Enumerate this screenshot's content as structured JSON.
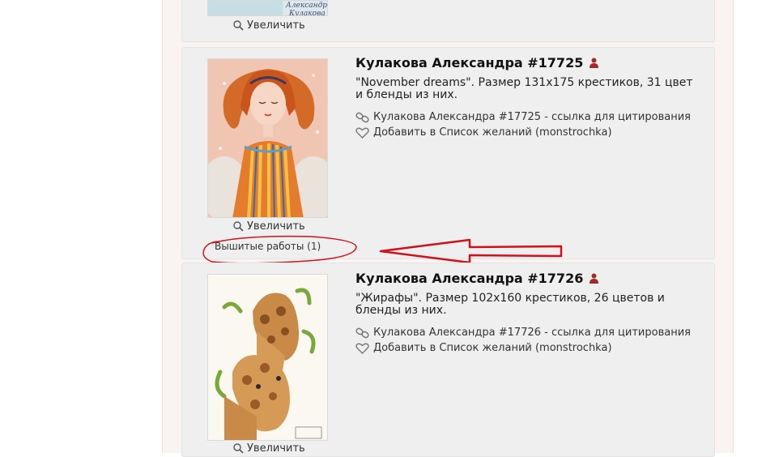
{
  "zoom_label": "Увеличить",
  "top_card": {
    "thumb_text_1": "Александра",
    "thumb_text_2": "Кулакова"
  },
  "items": [
    {
      "title": "Кулакова Александра #17725",
      "description": "\"November dreams\". Размер 131х175 крестиков, 31 цвет и бленды из них.",
      "cite_link": "Кулакова Александра #17725 - ссылка для цитирования",
      "wishlist_link": "Добавить в Список желаний (monstrochka)",
      "embroidered_link": "Вышитые работы (1)"
    },
    {
      "title": "Кулакова Александра #17726",
      "description": "\"Жирафы\". Размер 102х160 крестиков, 26 цветов и бленды из них.",
      "cite_link": "Кулакова Александра #17726 - ссылка для цитирования",
      "wishlist_link": "Добавить в Список желаний (monstrochka)"
    }
  ],
  "colors": {
    "annotation_red": "#d0101a",
    "user_icon": "#a32a2a",
    "card_bg": "#efefef",
    "page_bg": "#fbf3f1"
  }
}
